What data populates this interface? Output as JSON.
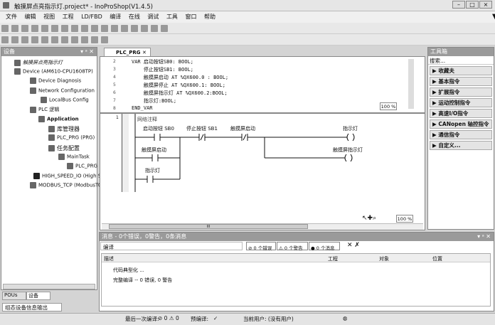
{
  "window": {
    "title": "触摸屏点亮指示灯.project* - InoProShop(V1.4.5)"
  },
  "menu": [
    "文件",
    "编辑",
    "视图",
    "工程",
    "LD/FBD",
    "编译",
    "在线",
    "调试",
    "工具",
    "窗口",
    "帮助"
  ],
  "devices": {
    "title": "设备",
    "items": [
      "触摸屏点亮指示灯",
      "Device (AM610-CPU1608TP)",
      "Device Diagnosis",
      "Network Configuration",
      "LocalBus Config",
      "PLC 逻辑",
      "Application",
      "库管理器",
      "PLC_PRG (PRG)",
      "任务配置",
      "MainTask",
      "PLC_PRG",
      "HIGH_SPEED_IO (High S",
      "MODBUS_TCP (ModbusTCP"
    ]
  },
  "left_tabs": {
    "pous": "POUs",
    "devices": "设备",
    "output": "组态设备信息输出"
  },
  "editor": {
    "tab": "PLC_PRG",
    "zoom": "100 %",
    "zoom2": "100 %",
    "line_numbers": [
      "2",
      "3",
      "4",
      "5",
      "6",
      "7",
      "8"
    ],
    "code": [
      "VAR 启动按钮SB0: BOOL;",
      "    停止按钮SB1: BOOL;",
      "    触摸屏启动 AT %QX600.0 : BOOL;",
      "    触摸屏停止 AT %QX600.1: BOOL;",
      "    触摸屏指示灯 AT %QX600.2:BOOL;",
      "    指示灯:BOOL;",
      "END_VAR"
    ],
    "network_no": "1",
    "network_comment": "网络注释",
    "ladder": {
      "c1": "启动按钮 SB0",
      "c2": "停止按钮 SB1",
      "c3": "触摸屏启动",
      "c4": "触摸屏启动",
      "c5": "指示灯",
      "coil1": "指示灯",
      "coil2": "触摸屏指示灯"
    },
    "hscroll": "III"
  },
  "toolbox": {
    "title": "工具箱",
    "search": "搜索...",
    "items": [
      "收藏夫",
      "基本指令",
      "扩展指令",
      "运动控制指令",
      "高速I/O指令",
      "CANopen 轴控指令",
      "通信指令",
      "自定义..."
    ]
  },
  "messages": {
    "title": "消息 - 0个错误，0警告，0条消息",
    "filter": "编译",
    "errors": "0 个错误",
    "warnings": "0 个警告",
    "infos": "0 个消息",
    "columns": [
      "描述",
      "工程",
      "对象",
      "位置"
    ],
    "rows": [
      "代码典型化 ...",
      "完整编译 -- 0 错误, 0 警告"
    ]
  },
  "status": {
    "last_compile": "最后一次编译:",
    "err": "0",
    "warn": "0",
    "precompile": "预编译:",
    "user": "当前用户: (没有用户)"
  }
}
